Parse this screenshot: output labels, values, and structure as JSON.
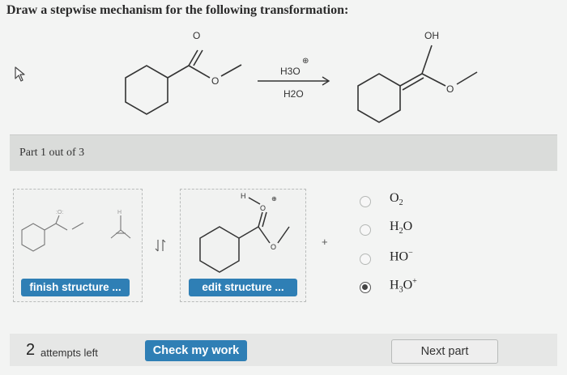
{
  "question": {
    "title": "Draw a stepwise mechanism for the following transformation:"
  },
  "reaction": {
    "reagent_top": "H3O",
    "reagent_top_charge": "⊕",
    "reagent_bottom": "H2O",
    "reactant_carbonyl_label": "O",
    "reactant_ether_label": "O",
    "product_hydroxyl_label": "OH",
    "product_ether_label": "O"
  },
  "part": {
    "label": "Part 1 out of 3"
  },
  "workspace": {
    "box1_button_label": "finish structure ...",
    "box2_button_label": "edit structure ...",
    "box2_atom_o_label": "O",
    "box2_atom_h_label": "H",
    "box2_charge": "⊕",
    "box2_ester_o_label": "O",
    "equilibrium_icon": "equilibrium-arrows-icon",
    "plus_sign": "+"
  },
  "reagents": {
    "options": [
      {
        "base": "O",
        "sub": "2",
        "sup": "",
        "selected": false
      },
      {
        "base": "H",
        "sub": "2",
        "tail": "O",
        "sup": "",
        "selected": false
      },
      {
        "base": "HO",
        "sub": "",
        "sup": "−",
        "selected": false
      },
      {
        "base": "H",
        "sub": "3",
        "tail": "O",
        "sup": "+",
        "selected": true
      }
    ]
  },
  "footer": {
    "attempts_count": "2",
    "attempts_label": "attempts left",
    "check_button": "Check my work",
    "next_button": "Next part"
  },
  "colors": {
    "accent_blue": "#2f7fb5",
    "bond": "#333333"
  }
}
